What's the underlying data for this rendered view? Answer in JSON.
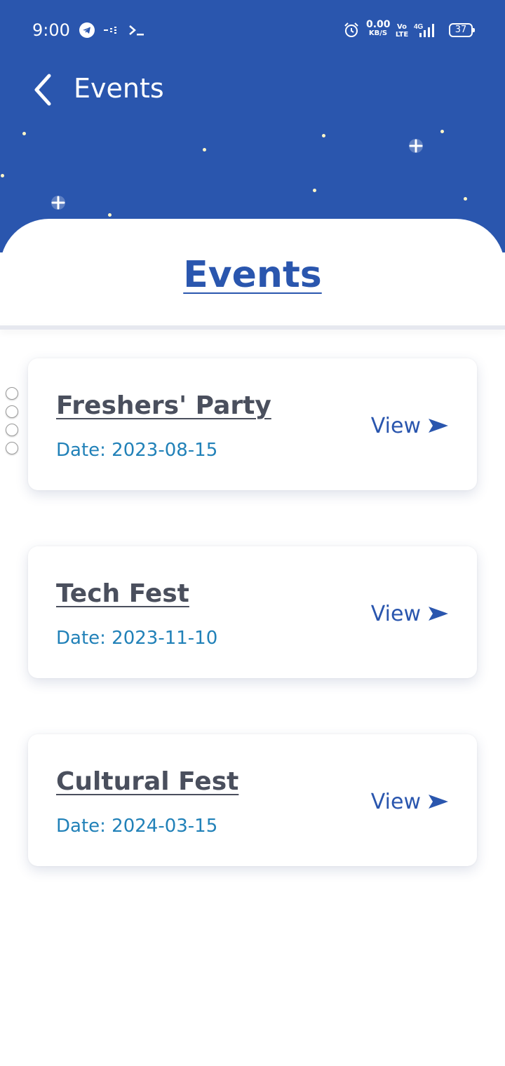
{
  "status_bar": {
    "time": "9:00",
    "network_speed_value": "0.00",
    "network_speed_unit": "KB/S",
    "volte_top": "Vo",
    "volte_bottom": "LTE",
    "network_type": "4G",
    "battery": "37",
    "icons": [
      "telegram-icon",
      "dots-icon",
      "terminal-icon",
      "alarm-icon",
      "signal-icon",
      "battery-icon"
    ]
  },
  "app_bar": {
    "title": "Events",
    "back_icon": "chevron-left-icon"
  },
  "section": {
    "title": "Events"
  },
  "events": [
    {
      "name": "Freshers' Party",
      "date": "Date: 2023-08-15",
      "view_label": "View"
    },
    {
      "name": "Tech Fest",
      "date": "Date: 2023-11-10",
      "view_label": "View"
    },
    {
      "name": "Cultural Fest",
      "date": "Date: 2024-03-15",
      "view_label": "View"
    }
  ],
  "colors": {
    "primary": "#2a56ae",
    "event_title": "#4a4f5d",
    "date_text": "#2181b8",
    "star": "#fff6c8"
  }
}
